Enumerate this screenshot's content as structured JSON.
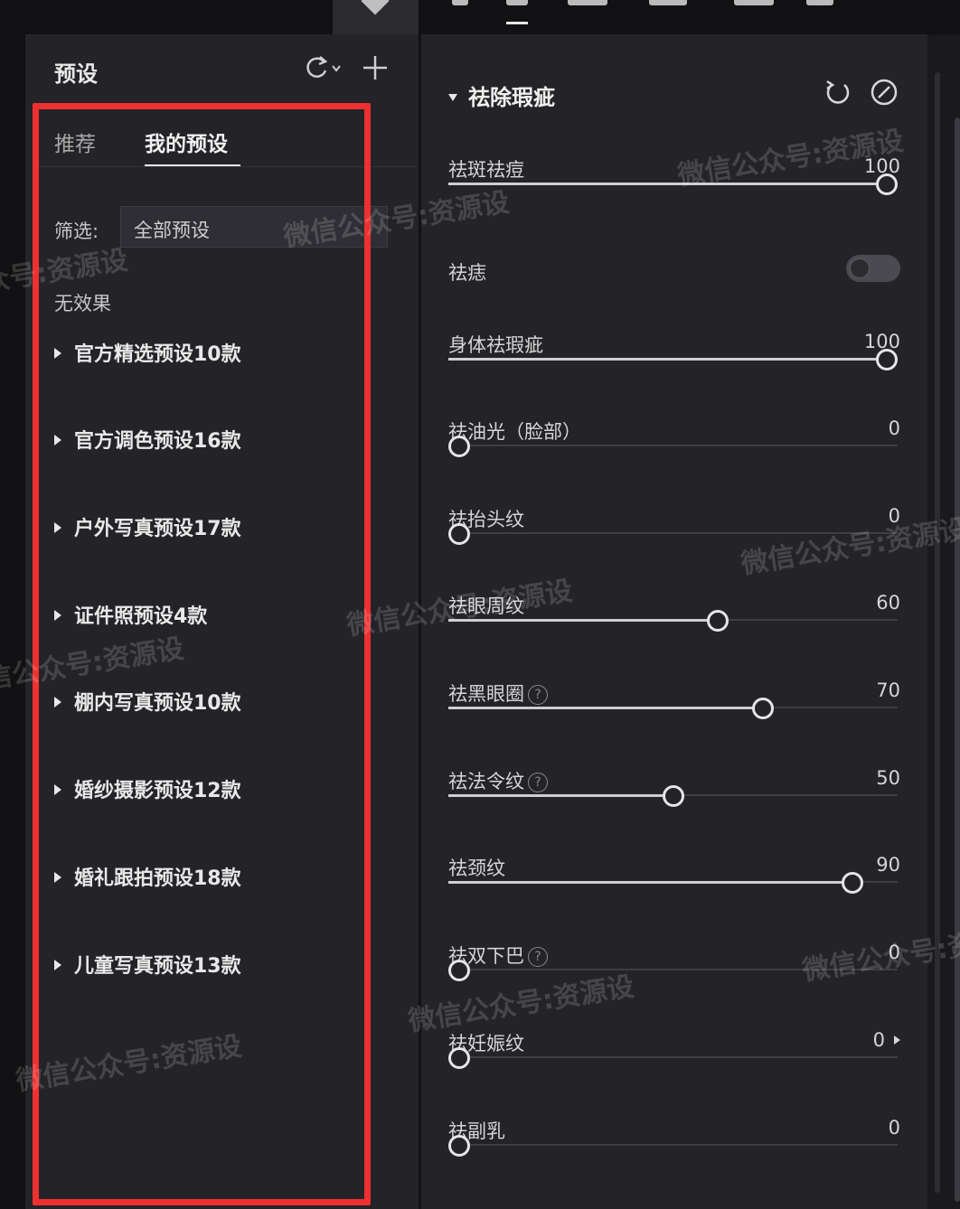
{
  "left_panel": {
    "title": "预设",
    "tabs": [
      "推荐",
      "我的预设"
    ],
    "filter_label": "筛选:",
    "filter_value": "全部预设",
    "no_effect": "无效果",
    "groups": [
      "官方精选预设10款",
      "官方调色预设16款",
      "户外写真预设17款",
      "证件照预设4款",
      "棚内写真预设10款",
      "婚纱摄影预设12款",
      "婚礼跟拍预设18款",
      "儿童写真预设13款"
    ]
  },
  "right_panel": {
    "section_title": "祛除瑕疵",
    "toggle": {
      "label": "祛痣",
      "on": false
    },
    "sliders": [
      {
        "label": "祛斑祛痘",
        "value": "100",
        "level": 100,
        "help": false,
        "arrow": false
      },
      {
        "label": "身体祛瑕疵",
        "value": "100",
        "level": 100,
        "help": false,
        "arrow": false
      },
      {
        "label": "祛油光（脸部）",
        "value": "0",
        "level": 0,
        "help": false,
        "arrow": false
      },
      {
        "label": "祛抬头纹",
        "value": "0",
        "level": 0,
        "help": false,
        "arrow": false
      },
      {
        "label": "祛眼周纹",
        "value": "60",
        "level": 60,
        "help": false,
        "arrow": false
      },
      {
        "label": "祛黑眼圈",
        "value": "70",
        "level": 70,
        "help": true,
        "arrow": false
      },
      {
        "label": "祛法令纹",
        "value": "50",
        "level": 50,
        "help": true,
        "arrow": false
      },
      {
        "label": "祛颈纹",
        "value": "90",
        "level": 90,
        "help": false,
        "arrow": false
      },
      {
        "label": "祛双下巴",
        "value": "0",
        "level": 0,
        "help": true,
        "arrow": false
      },
      {
        "label": "祛妊娠纹",
        "value": "0",
        "level": 0,
        "help": false,
        "arrow": true
      },
      {
        "label": "祛副乳",
        "value": "0",
        "level": 0,
        "help": false,
        "arrow": false
      }
    ]
  },
  "watermark": "微信公众号:资源设",
  "icons": {
    "refresh": "refresh-dropdown-icon",
    "add": "plus-icon",
    "reset": "reset-icon",
    "disable": "disable-icon",
    "help": "help-circle-icon"
  },
  "colors": {
    "highlight": "#ef3030",
    "panel": "#232328",
    "text": "#d6d6d6"
  }
}
